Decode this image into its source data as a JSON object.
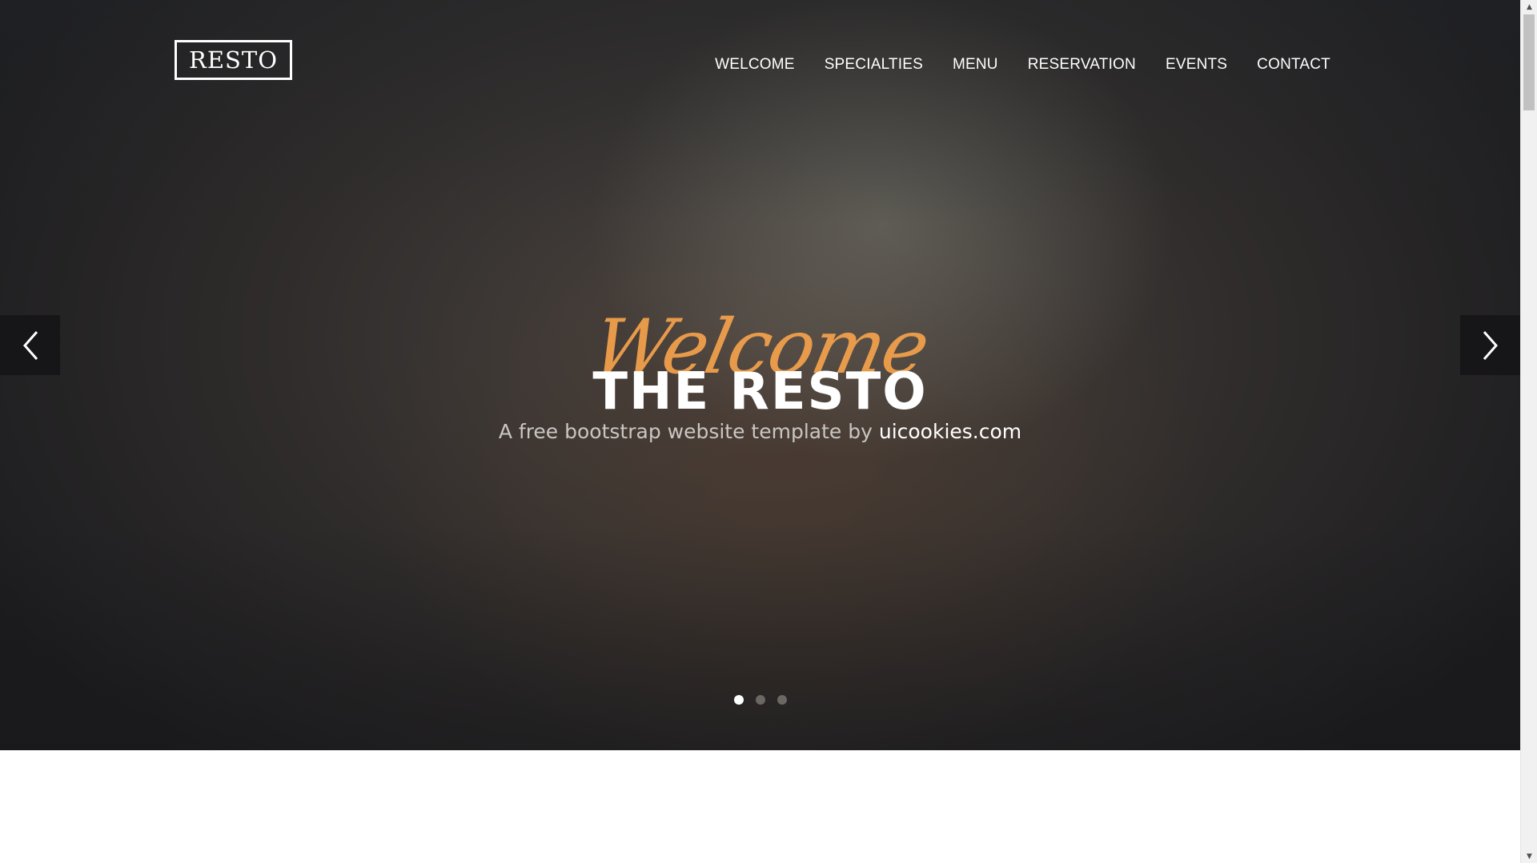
{
  "header": {
    "logo": "RESTO",
    "nav": [
      "WELCOME",
      "SPECIALTIES",
      "MENU",
      "RESERVATION",
      "EVENTS",
      "CONTACT"
    ]
  },
  "hero": {
    "script_title": "Welcome",
    "title": "THE RESTO",
    "tagline_prefix": "A free bootstrap website template by ",
    "tagline_link": "uicookies.com",
    "active_slide": 1,
    "slide_count": 3
  },
  "icons": {
    "prev": "chevron-left-icon",
    "next": "chevron-right-icon"
  },
  "colors": {
    "accent": "#f0a04b",
    "hero_dark": "#1c1c1f",
    "text": "#ffffff"
  }
}
